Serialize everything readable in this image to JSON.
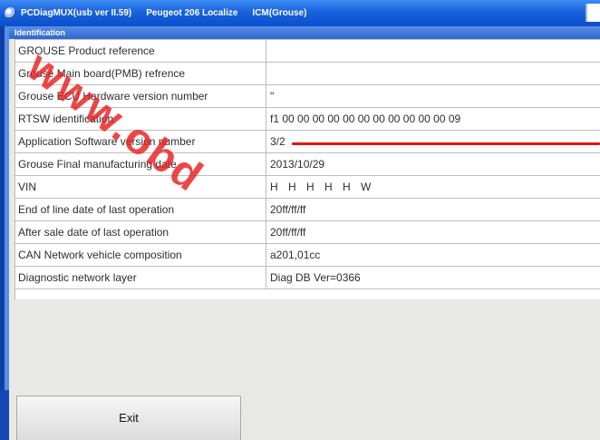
{
  "window": {
    "title_app": "PCDiagMUX(usb ver II.59)",
    "title_vehicle": "Peugeot 206 Localize",
    "title_ecu": "ICM(Grouse)"
  },
  "group": {
    "header": "Identification"
  },
  "rows": [
    {
      "label": "GROUSE Product reference",
      "value": ""
    },
    {
      "label": "Grouse Main board(PMB) refrence",
      "value": ""
    },
    {
      "label": "Grouse ECU Hardware version number",
      "value": "\""
    },
    {
      "label": "RTSW identification",
      "value": "f1 00 00 00 00 00 00 00 00 00 00 00 09"
    },
    {
      "label": "Application Software version number",
      "value": "3/2"
    },
    {
      "label": "Grouse Final manufacturing date",
      "value": "2013/10/29"
    },
    {
      "label": "VIN",
      "value": "H H H H H W"
    },
    {
      "label": "End of line date of last operation",
      "value": "20ff/ff/ff"
    },
    {
      "label": "After sale date of last operation",
      "value": "20ff/ff/ff"
    },
    {
      "label": "CAN Network vehicle composition",
      "value": "a201,01cc"
    },
    {
      "label": "Diagnostic network layer",
      "value": "Diag DB Ver=0366"
    }
  ],
  "underline_glyph": "_",
  "buttons": {
    "exit": "Exit"
  },
  "watermark": {
    "text": "www.obd"
  },
  "colors": {
    "title_bar": "#1a62dc",
    "highlight_line": "#e81010",
    "watermark": "#e81e1e"
  }
}
